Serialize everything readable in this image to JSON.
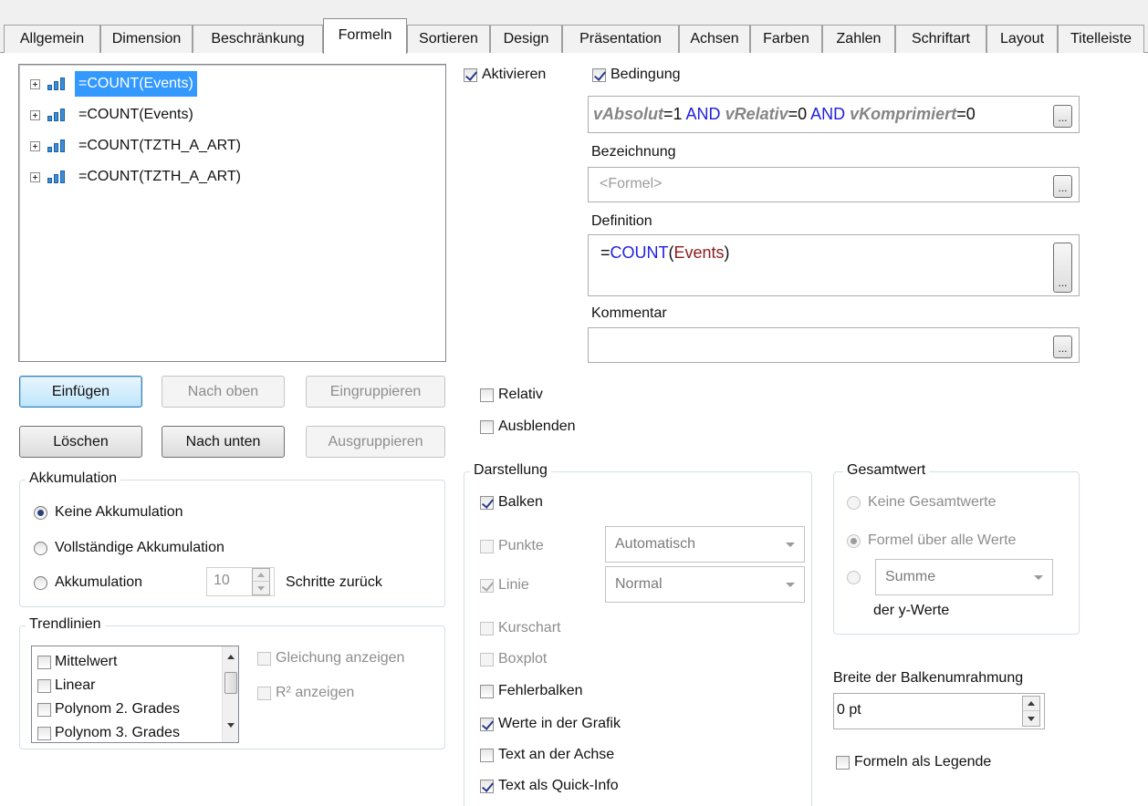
{
  "tabs": [
    "Allgemein",
    "Dimension",
    "Beschränkung",
    "Formeln",
    "Sortieren",
    "Design",
    "Präsentation",
    "Achsen",
    "Farben",
    "Zahlen",
    "Schriftart",
    "Layout",
    "Titelleiste"
  ],
  "active_tab": "Formeln",
  "formulas": [
    {
      "label": "=COUNT(Events)",
      "selected": true
    },
    {
      "label": "=COUNT(Events)",
      "selected": false
    },
    {
      "label": "=COUNT(TZTH_A_ART)",
      "selected": false
    },
    {
      "label": "=COUNT(TZTH_A_ART)",
      "selected": false
    }
  ],
  "buttons": {
    "insert": "Einfügen",
    "move_up": "Nach oben",
    "group": "Eingruppieren",
    "delete": "Löschen",
    "move_down": "Nach unten",
    "ungroup": "Ausgruppieren",
    "dots": "..."
  },
  "accumulation": {
    "title": "Akkumulation",
    "none": "Keine Akkumulation",
    "full": "Vollständige Akkumulation",
    "acc": "Akkumulation",
    "steps_value": "10",
    "steps_suffix": "Schritte zurück",
    "selected": "none"
  },
  "trendlines": {
    "title": "Trendlinien",
    "items": [
      "Mittelwert",
      "Linear",
      "Polynom 2. Grades",
      "Polynom 3. Grades"
    ],
    "show_equation": "Gleichung anzeigen",
    "show_r2": "R² anzeigen"
  },
  "activate": {
    "label": "Aktivieren",
    "checked": true
  },
  "condition": {
    "label": "Bedingung",
    "checked": true,
    "tokens": {
      "v1": "vAbsolut",
      "eq1": "=1 ",
      "and1": "AND ",
      "v2": "vRelativ",
      "eq2": "=0 ",
      "and2": "AND ",
      "v3": "vKomprimiert",
      "eq3": "=0"
    }
  },
  "label_section": {
    "title": "Bezeichnung",
    "placeholder": "<Formel>"
  },
  "definition": {
    "title": "Definition",
    "prefix": "=",
    "func": "COUNT",
    "open": "(",
    "arg": "Events",
    "close": ")"
  },
  "comment": {
    "title": "Kommentar",
    "value": ""
  },
  "relativ": {
    "label": "Relativ",
    "checked": false
  },
  "hide": {
    "label": "Ausblenden",
    "checked": false
  },
  "display": {
    "title": "Darstellung",
    "bars": "Balken",
    "points": "Punkte",
    "points_combo": "Automatisch",
    "line": "Linie",
    "line_combo": "Normal",
    "stock": "Kurschart",
    "boxplot": "Boxplot",
    "errorbars": "Fehlerbalken",
    "values_in_chart": "Werte in der Grafik",
    "text_on_axis": "Text an der Achse",
    "text_as_tooltip": "Text als Quick-Info"
  },
  "total": {
    "title": "Gesamtwert",
    "none": "Keine Gesamtwerte",
    "formula_all": "Formel über alle Werte",
    "sum_combo": "Summe",
    "of_y": "der y-Werte"
  },
  "bar_border": {
    "title": "Breite der Balkenumrahmung",
    "value": "0 pt"
  },
  "formulas_as_legend": "Formeln als Legende"
}
